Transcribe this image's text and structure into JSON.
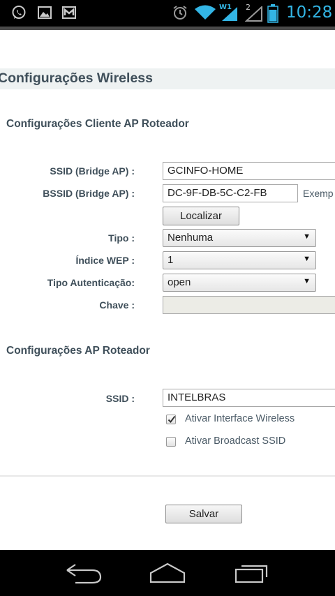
{
  "status_bar": {
    "time": "10:28",
    "network_label": "W1",
    "sim_number": "2",
    "icons": [
      "whatsapp-icon",
      "gallery-icon",
      "gmail-icon",
      "alarm-icon",
      "wifi-icon",
      "signal-icon",
      "signal-2-icon",
      "battery-icon"
    ]
  },
  "page": {
    "title": "Configurações Wireless"
  },
  "client_section": {
    "title": "Configurações Cliente AP Roteador",
    "ssid_label": "SSID (Bridge AP) :",
    "ssid_value": "GCINFO-HOME",
    "bssid_label": "BSSID (Bridge AP) :",
    "bssid_value": "DC-9F-DB-5C-C2-FB",
    "bssid_hint": "Exemp",
    "locate_button": "Localizar",
    "tipo_label": "Tipo :",
    "tipo_value": "Nenhuma",
    "wep_index_label": "Índice WEP :",
    "wep_index_value": "1",
    "auth_label": "Tipo Autenticação:",
    "auth_value": "open",
    "key_label": "Chave :",
    "key_value": ""
  },
  "ap_section": {
    "title": "Configurações AP Roteador",
    "ssid_label": "SSID :",
    "ssid_value": "INTELBRAS",
    "enable_wireless_label": "Ativar Interface Wireless",
    "enable_wireless_checked": true,
    "broadcast_ssid_label": "Ativar Broadcast SSID",
    "broadcast_ssid_checked": false
  },
  "actions": {
    "save_button": "Salvar"
  },
  "colors": {
    "label_text": "#3f4f5a",
    "title_band": "#eef2f2",
    "accent_blue": "#33b5e5"
  },
  "nav_bar": {
    "icons": [
      "back-icon",
      "home-icon",
      "recent-apps-icon"
    ]
  }
}
